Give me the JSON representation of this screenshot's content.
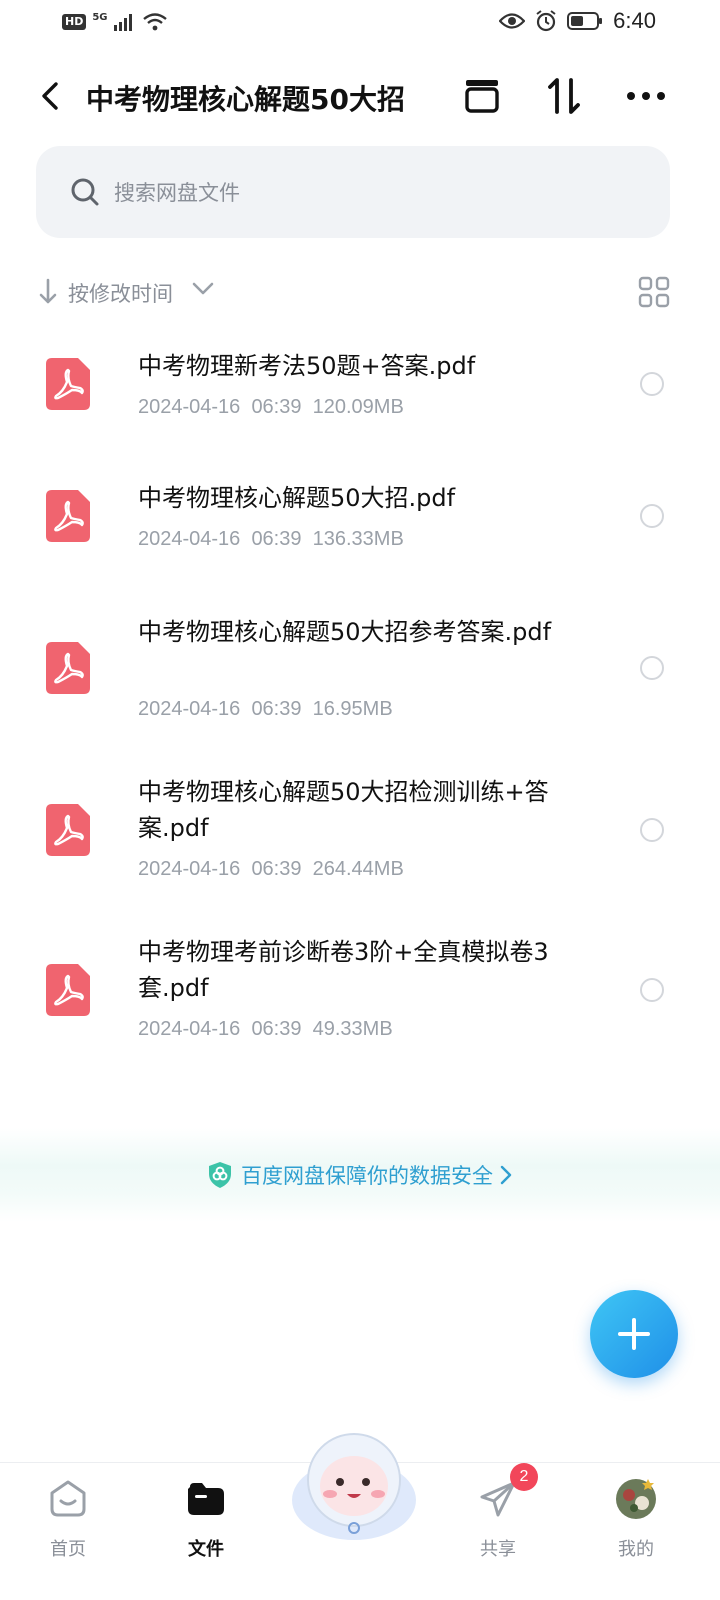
{
  "status_bar": {
    "hd": "HD",
    "network": "5G",
    "time": "6:40"
  },
  "header": {
    "title": "中考物理核心解题50大招"
  },
  "search": {
    "placeholder": "搜索网盘文件"
  },
  "sort": {
    "label": "按修改时间"
  },
  "files": [
    {
      "name": "中考物理新考法50题+答案.pdf",
      "date": "2024-04-16",
      "time": "06:39",
      "size": "120.09MB"
    },
    {
      "name": "中考物理核心解题50大招.pdf",
      "date": "2024-04-16",
      "time": "06:39",
      "size": "136.33MB"
    },
    {
      "name": "中考物理核心解题50大招参考答案.pdf",
      "date": "2024-04-16",
      "time": "06:39",
      "size": "16.95MB"
    },
    {
      "name": "中考物理核心解题50大招检测训练+答案.pdf",
      "date": "2024-04-16",
      "time": "06:39",
      "size": "264.44MB"
    },
    {
      "name": "中考物理考前诊断卷3阶+全真模拟卷3套.pdf",
      "date": "2024-04-16",
      "time": "06:39",
      "size": "49.33MB"
    }
  ],
  "security_banner": {
    "text": "百度网盘保障你的数据安全"
  },
  "nav": {
    "home": "首页",
    "files": "文件",
    "share": "共享",
    "share_badge": "2",
    "mine": "我的"
  },
  "colors": {
    "pdf_red": "#f0646f",
    "accent_blue": "#1f8fe8",
    "security_text": "#2f9fd0",
    "badge_red": "#f2465a"
  },
  "icons": [
    "back-arrow-icon",
    "archive-box-icon",
    "sort-swap-icon",
    "more-dots-icon",
    "search-icon",
    "sort-down-arrow-icon",
    "chevron-down-icon",
    "grid-view-icon",
    "pdf-file-icon",
    "shield-icon",
    "chevron-right-icon",
    "plus-icon",
    "home-icon",
    "folder-icon",
    "paper-plane-icon",
    "avatar"
  ]
}
